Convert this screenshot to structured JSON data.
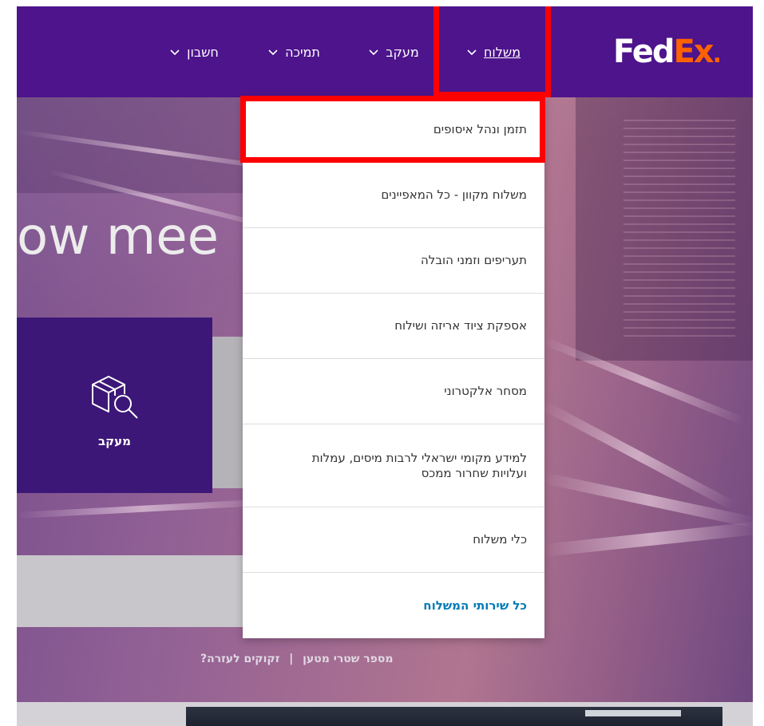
{
  "header": {
    "logo_fed": "Fed",
    "logo_ex": "Ex",
    "logo_dot": ".",
    "nav": [
      {
        "label": "משלוח",
        "icon": "chevron-down-icon"
      },
      {
        "label": "מעקב",
        "icon": "chevron-down-icon"
      },
      {
        "label": "תמיכה",
        "icon": "chevron-down-icon"
      },
      {
        "label": "חשבון",
        "icon": "chevron-down-icon"
      }
    ]
  },
  "dropdown": {
    "items": [
      "תזמן ונהל איסופים",
      "משלוח מקוון - כל המאפיינים",
      "תעריפים וזמני הובלה",
      "אספקת ציוד אריזה ושילוח",
      "מסחר אלקטרוני",
      "למידע מקומי ישראלי לרבות מיסים, עמלות ועלויות שחרור ממכס",
      "כלי משלוח"
    ],
    "all_services": "כל שירותי המשלוח"
  },
  "hero": {
    "heading_fragment": "ow mee",
    "tracking_card_label": "מעקב",
    "tracking_card_icon": "package-search-icon",
    "link_shipment_number": "מספר שטרי מטען",
    "separator": "|",
    "link_need_help": "זקוקים לעזרה?"
  },
  "colors": {
    "brand_purple": "#4d148c",
    "brand_orange": "#ff6200",
    "card_purple": "#3c1777",
    "link_blue": "#007ab7",
    "highlight_red": "#ff0000"
  }
}
